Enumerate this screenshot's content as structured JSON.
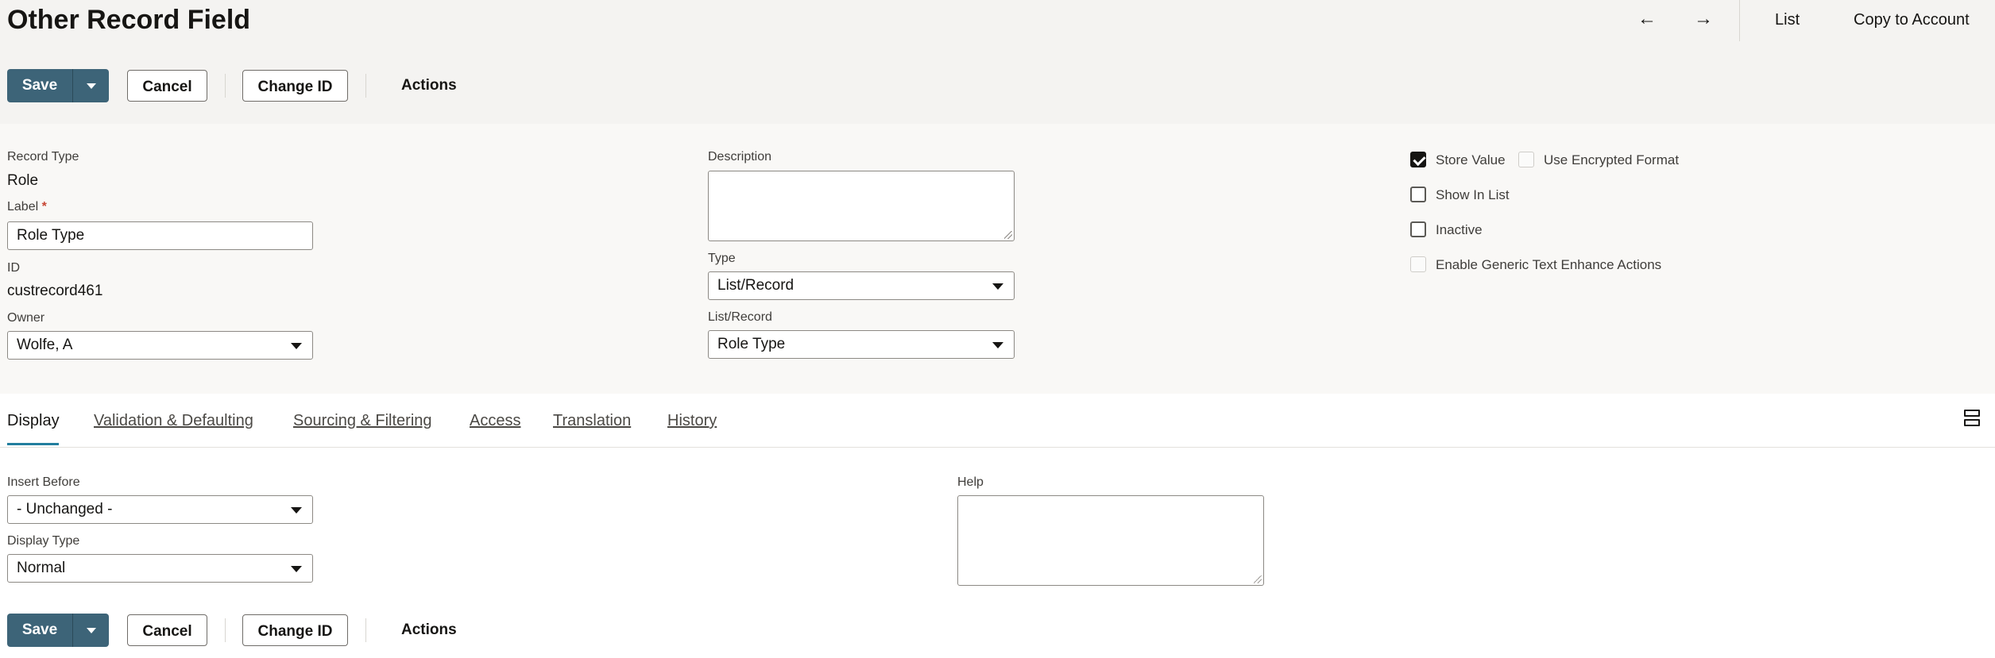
{
  "page": {
    "title": "Other Record Field"
  },
  "topnav": {
    "prev_icon": "arrow-left-icon",
    "prev": "←",
    "next_icon": "arrow-right-icon",
    "next": "→",
    "list": "List",
    "copy_to_account": "Copy to Account"
  },
  "toolbar": {
    "save": "Save",
    "cancel": "Cancel",
    "change_id": "Change ID",
    "actions": "Actions"
  },
  "fields": {
    "record_type_label": "Record Type",
    "record_type_value": "Role",
    "label_label": "Label",
    "label_required": "*",
    "label_value": "Role Type",
    "id_label": "ID",
    "id_value": "custrecord461",
    "owner_label": "Owner",
    "owner_value": "Wolfe, A",
    "description_label": "Description",
    "description_value": "",
    "type_label": "Type",
    "type_value": "List/Record",
    "list_record_label": "List/Record",
    "list_record_value": "Role Type"
  },
  "checkboxes": {
    "store_value": {
      "label": "Store Value",
      "checked": true
    },
    "use_encrypted_format": {
      "label": "Use Encrypted Format",
      "checked": false,
      "disabled": true
    },
    "show_in_list": {
      "label": "Show In List",
      "checked": false
    },
    "inactive": {
      "label": "Inactive",
      "checked": false
    },
    "enable_generic_text_enhance_actions": {
      "label": "Enable Generic Text Enhance Actions",
      "checked": false,
      "disabled": true
    }
  },
  "tabs": [
    {
      "label": "Display",
      "active": true
    },
    {
      "label": "Validation & Defaulting",
      "active": false
    },
    {
      "label": "Sourcing & Filtering",
      "active": false
    },
    {
      "label": "Access",
      "active": false
    },
    {
      "label": "Translation",
      "active": false
    },
    {
      "label": "History",
      "active": false
    }
  ],
  "display_tab": {
    "insert_before_label": "Insert Before",
    "insert_before_value": "- Unchanged -",
    "display_type_label": "Display Type",
    "display_type_value": "Normal",
    "help_label": "Help",
    "help_value": ""
  },
  "colors": {
    "primary_button": "#3d6478",
    "active_tab_underline": "#227e9e",
    "required_marker": "#c74634"
  }
}
